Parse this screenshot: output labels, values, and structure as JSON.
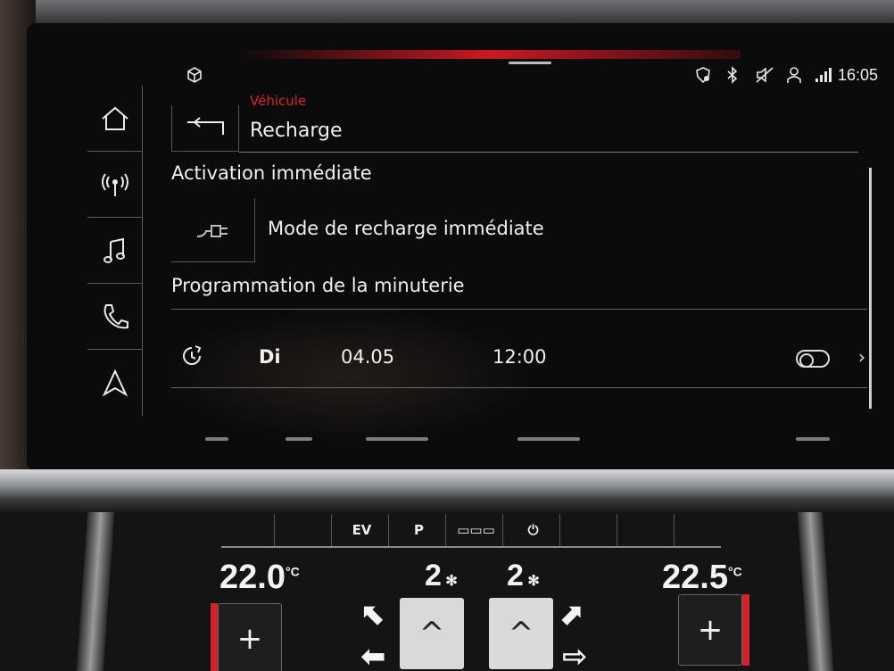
{
  "status_bar": {
    "time": "16:05",
    "icons": [
      "car-settings-icon",
      "navigation-shield-icon",
      "bluetooth-icon",
      "mute-icon",
      "user-icon",
      "signal-icon"
    ]
  },
  "sidebar": {
    "items": [
      {
        "icon": "home-icon"
      },
      {
        "icon": "radio-icon"
      },
      {
        "icon": "music-icon"
      },
      {
        "icon": "phone-icon"
      },
      {
        "icon": "navigation-icon"
      }
    ]
  },
  "header": {
    "breadcrumb": "Véhicule",
    "title": "Recharge"
  },
  "sections": {
    "immediate": "Activation immédiate",
    "immediate_mode": "Mode de recharge immédiate",
    "timer": "Programmation de la minuterie"
  },
  "timer_row": {
    "day": "Di",
    "date": "04.05",
    "time": "12:00",
    "enabled": false
  },
  "climate": {
    "left_temp": "22.0",
    "left_unit": "°C",
    "right_temp": "22.5",
    "right_unit": "°C",
    "left_fan": "2",
    "right_fan": "2",
    "top_buttons": [
      "EV",
      "P",
      "▭▭▭",
      "⏻"
    ],
    "plus_label": "+",
    "up_label": "^"
  }
}
